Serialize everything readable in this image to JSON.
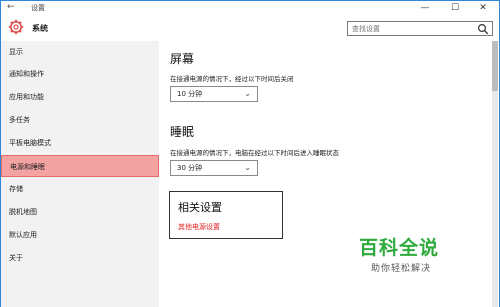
{
  "titlebar": {
    "back_glyph": "←",
    "title": "设置",
    "minimize_glyph": "—",
    "maximize_glyph": "☐",
    "close_glyph": "✕"
  },
  "header": {
    "app_name": "系统",
    "gear_icon_color": "#d9534f"
  },
  "search": {
    "placeholder": "查找设置"
  },
  "sidebar": {
    "items": [
      {
        "label": "显示"
      },
      {
        "label": "通知和操作"
      },
      {
        "label": "应用和功能"
      },
      {
        "label": "多任务"
      },
      {
        "label": "平板电脑模式"
      },
      {
        "label": "电源和睡眠"
      },
      {
        "label": "存储"
      },
      {
        "label": "脱机地图"
      },
      {
        "label": "默认应用"
      },
      {
        "label": "关于"
      }
    ],
    "active_index": 5
  },
  "screen": {
    "title": "屏幕",
    "description": "在接通电源的情况下，经过以下时间后关闭",
    "value": "10 分钟"
  },
  "sleep": {
    "title": "睡眠",
    "description": "在接通电源的情况下，电脑在经过以下时间后进入睡眠状态",
    "value": "30 分钟"
  },
  "related": {
    "title": "相关设置",
    "link": "其他电源设置"
  },
  "watermark": {
    "big": "百科全说",
    "small": "助你轻松解决"
  },
  "colors": {
    "active_bg": "#f4a3a3",
    "link": "#e02020",
    "watermark_green": "#2faa3c"
  }
}
